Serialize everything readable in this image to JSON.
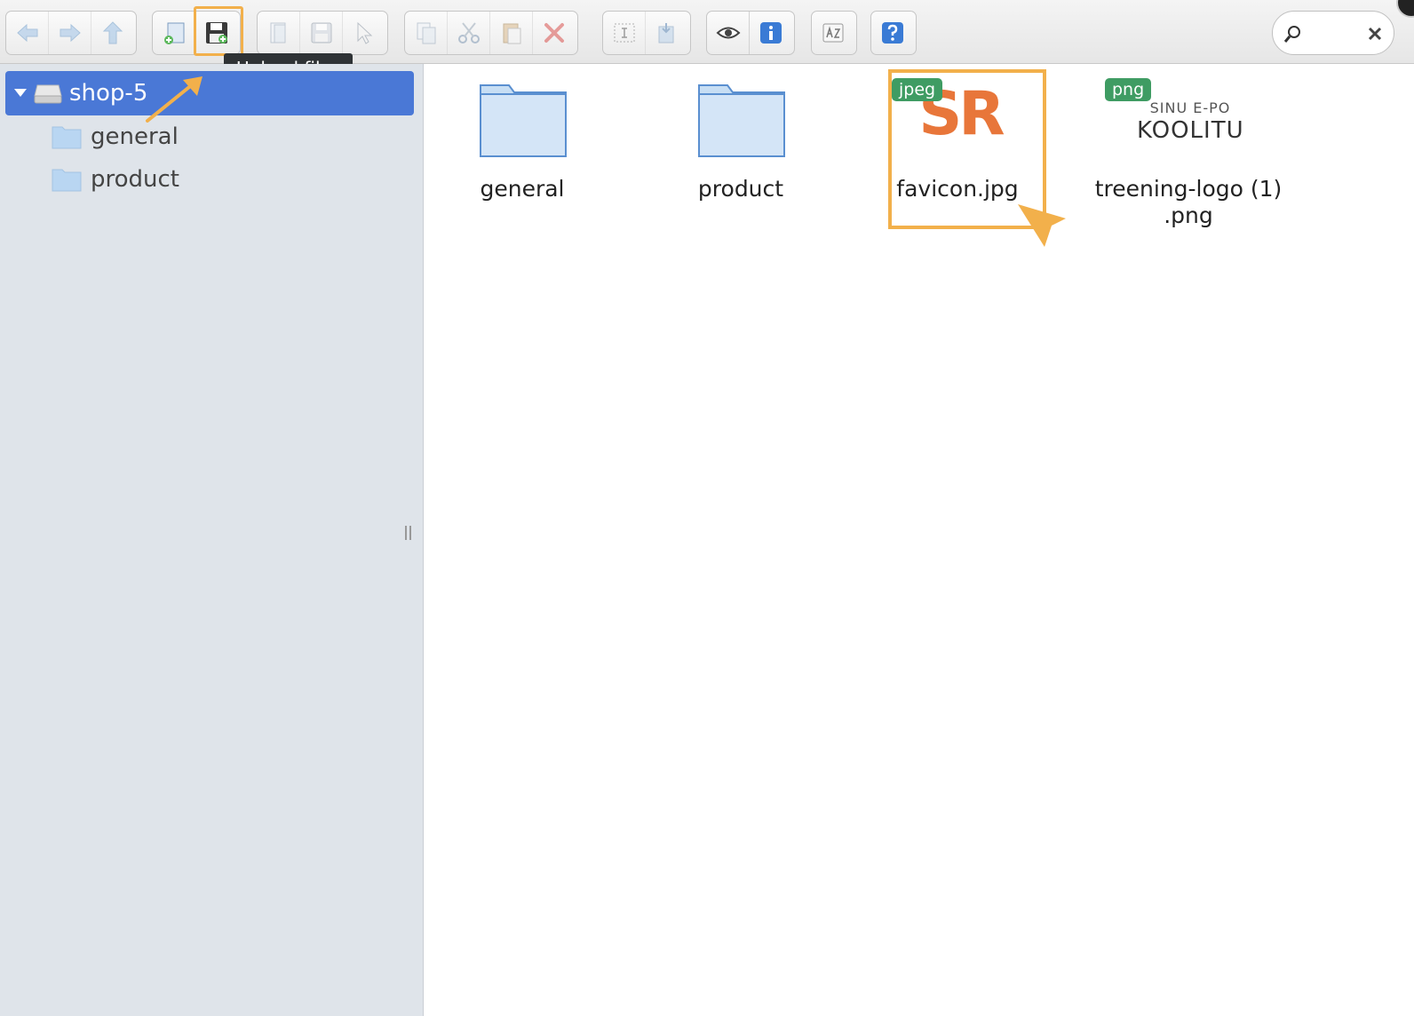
{
  "toolbar": {
    "groups": [
      {
        "buttons": [
          {
            "name": "back-button",
            "icon": "arrow-left-icon"
          },
          {
            "name": "forward-button",
            "icon": "arrow-right-icon"
          },
          {
            "name": "up-button",
            "icon": "arrow-up-icon"
          }
        ]
      },
      {
        "buttons": [
          {
            "name": "new-folder-button",
            "icon": "new-folder-icon"
          },
          {
            "name": "upload-files-button",
            "icon": "floppy-upload-icon"
          }
        ]
      },
      {
        "buttons": [
          {
            "name": "open-button",
            "icon": "open-icon"
          },
          {
            "name": "save-button",
            "icon": "floppy-icon"
          },
          {
            "name": "select-button",
            "icon": "cursor-icon"
          }
        ]
      },
      {
        "buttons": [
          {
            "name": "copy-button",
            "icon": "copy-icon"
          },
          {
            "name": "cut-button",
            "icon": "scissors-icon"
          },
          {
            "name": "paste-button",
            "icon": "clipboard-icon"
          },
          {
            "name": "delete-button",
            "icon": "x-icon"
          }
        ]
      },
      {
        "buttons": [
          {
            "name": "rename-button",
            "icon": "text-cursor-icon"
          },
          {
            "name": "extract-button",
            "icon": "archive-icon"
          }
        ]
      },
      {
        "buttons": [
          {
            "name": "preview-button",
            "icon": "eye-icon"
          },
          {
            "name": "info-button",
            "icon": "info-icon"
          }
        ]
      },
      {
        "buttons": [
          {
            "name": "sort-button",
            "icon": "sort-az-icon"
          }
        ]
      },
      {
        "buttons": [
          {
            "name": "help-button",
            "icon": "help-icon"
          }
        ]
      }
    ],
    "tooltip": "Upload files"
  },
  "search": {
    "value": ""
  },
  "sidebar": {
    "root": {
      "label": "shop-5"
    },
    "items": [
      {
        "label": "general"
      },
      {
        "label": "product"
      }
    ]
  },
  "files": [
    {
      "name": "general",
      "kind": "folder"
    },
    {
      "name": "product",
      "kind": "folder"
    },
    {
      "name": "favicon.jpg",
      "kind": "image",
      "badge": "jpeg",
      "thumb_text": "SR"
    },
    {
      "name": "treening-logo (1)\n.png",
      "kind": "image",
      "badge": "png",
      "thumb_line1": "SINU E-PO",
      "thumb_line2": "KOOLITU"
    }
  ],
  "colors": {
    "selection": "#4a78d6",
    "highlight": "#f2b04b",
    "badge": "#3f9c63",
    "thumb_sr": "#e8763a"
  }
}
